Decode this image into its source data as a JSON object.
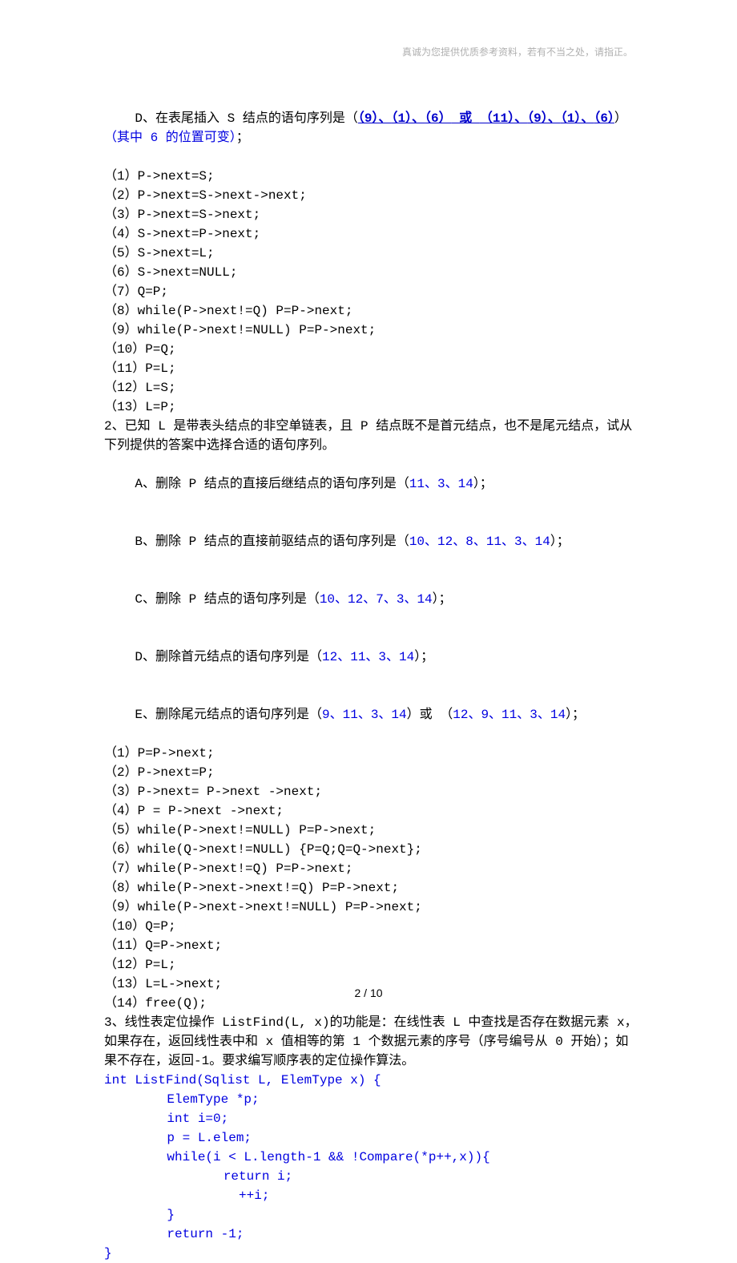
{
  "header": {
    "text": "真诚为您提供优质参考资料，若有不当之处，请指正。"
  },
  "content": {
    "q1": {
      "D_prefix": "D、在表尾插入 S 结点的语句序列是（",
      "D_u1": "（9）、",
      "D_u2": "（1）、",
      "D_u3": "（6）",
      "D_or": " 或 ",
      "D_u4": "（11）、",
      "D_u5": "（9）、",
      "D_u6": "（1）、",
      "D_u7": "（6）",
      "D_suffix_paren": "） ",
      "D_note": "（其中 6 的位置可变）",
      "D_semi": "；",
      "items": [
        "（1）P->next=S;",
        "（2）P->next=S->next->next;",
        "（3）P->next=S->next;",
        "（4）S->next=P->next;",
        "（5）S->next=L;",
        "（6）S->next=NULL;",
        "（7）Q=P;",
        "（8）while(P->next!=Q) P=P->next;",
        "（9）while(P->next!=NULL) P=P->next;",
        "（10）P=Q;",
        "（11）P=L;",
        "（12）L=S;",
        "（13）L=P;"
      ]
    },
    "q2": {
      "intro": "2、已知 L 是带表头结点的非空单链表，且 P 结点既不是首元结点，也不是尾元结点，试从下列提供的答案中选择合适的语句序列。",
      "A_pre": "A、删除 P 结点的直接后继结点的语句序列是（",
      "A_ans": "11、3、14",
      "A_suf": "）；",
      "B_pre": "B、删除 P 结点的直接前驱结点的语句序列是（",
      "B_ans": "10、12、8、11、3、14",
      "B_suf": "）；",
      "C_pre": "C、删除 P 结点的语句序列是（",
      "C_ans": "10、12、7、3、14",
      "C_suf": "）；",
      "D_pre": "D、删除首元结点的语句序列是（",
      "D_ans": "12、11、3、14",
      "D_suf": "）；",
      "E_pre": "E、删除尾元结点的语句序列是（",
      "E_ans1": "9、11、3、14",
      "E_mid": "）或 （",
      "E_ans2": "12、9、11、3、14",
      "E_suf": "）；",
      "items": [
        "（1）P=P->next;",
        "（2）P->next=P;",
        "（3）P->next= P->next ->next;",
        "（4）P = P->next ->next;",
        "（5）while(P->next!=NULL) P=P->next;",
        "（6）while(Q->next!=NULL) {P=Q;Q=Q->next};",
        "（7）while(P->next!=Q) P=P->next;",
        "（8）while(P->next->next!=Q) P=P->next;",
        "（9）while(P->next->next!=NULL) P=P->next;",
        "（10）Q=P;",
        "（11）Q=P->next;",
        "（12）P=L;",
        "（13）L=L->next;",
        "（14）free(Q);"
      ]
    },
    "q3": {
      "text": "3、线性表定位操作 ListFind(L, x)的功能是：在线性表 L 中查找是否存在数据元素 x，如果存在，返回线性表中和 x 值相等的第 1 个数据元素的序号（序号编号从 0 开始）；如果不存在，返回-1。要求编写顺序表的定位操作算法。",
      "code": [
        "int ListFind(Sqlist L, ElemType x) {",
        "    ElemType *p;",
        "    int i=0;",
        "    p = L.elem;",
        "    while(i < L.length-1 && !Compare(*p++,x)){",
        "        return i;",
        "          ++i;",
        "    }",
        "    return -1;",
        "}"
      ]
    }
  },
  "footer": {
    "text": "2 / 10"
  }
}
